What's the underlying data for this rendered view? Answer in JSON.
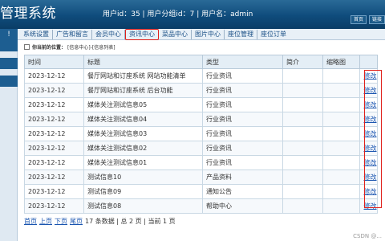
{
  "header": {
    "title": "管理系统",
    "user_info": "用户id：35 | 用户分组id：7 | 用户名：admin",
    "links": [
      "首页",
      "链接"
    ]
  },
  "nav": {
    "items": [
      "系统设置",
      "广告和留言",
      "会员中心",
      "资讯中心",
      "菜品中心",
      "图片中心",
      "座位管理",
      "座位订单"
    ],
    "active_index": 3
  },
  "breadcrumb": {
    "label": "你当前的位置：",
    "path": "[信息中心]-[信息列表]"
  },
  "table": {
    "columns": [
      "时间",
      "标题",
      "类型",
      "简介",
      "缩略图",
      ""
    ],
    "rows": [
      {
        "time": "2023-12-12",
        "title": "餐厅网站和订座系统 网站功能清单",
        "type": "行业资讯",
        "intro": "",
        "thumb": "",
        "action": "修改"
      },
      {
        "time": "2023-12-12",
        "title": "餐厅网站和订座系统 后台功能",
        "type": "行业资讯",
        "intro": "",
        "thumb": "",
        "action": "修改"
      },
      {
        "time": "2023-12-12",
        "title": "媒体关注测试信息05",
        "type": "行业资讯",
        "intro": "",
        "thumb": "",
        "action": "修改"
      },
      {
        "time": "2023-12-12",
        "title": "媒体关注测试信息04",
        "type": "行业资讯",
        "intro": "",
        "thumb": "",
        "action": "修改"
      },
      {
        "time": "2023-12-12",
        "title": "媒体关注测试信息03",
        "type": "行业资讯",
        "intro": "",
        "thumb": "",
        "action": "修改"
      },
      {
        "time": "2023-12-12",
        "title": "媒体关注测试信息02",
        "type": "行业资讯",
        "intro": "",
        "thumb": "",
        "action": "修改"
      },
      {
        "time": "2023-12-12",
        "title": "媒体关注测试信息01",
        "type": "行业资讯",
        "intro": "",
        "thumb": "",
        "action": "修改"
      },
      {
        "time": "2023-12-12",
        "title": "测试信息10",
        "type": "产品资料",
        "intro": "",
        "thumb": "",
        "action": "修改"
      },
      {
        "time": "2023-12-12",
        "title": "测试信息09",
        "type": "通知公告",
        "intro": "",
        "thumb": "",
        "action": "修改"
      },
      {
        "time": "2023-12-12",
        "title": "测试信息08",
        "type": "帮助中心",
        "intro": "",
        "thumb": "",
        "action": "修改"
      }
    ]
  },
  "pager": {
    "first": "首页",
    "prev": "上页",
    "next": "下页",
    "last": "尾页",
    "summary": "17 条数据 | 总 2 页 | 当前 1 页"
  },
  "watermark": "CSDN @...",
  "colors": {
    "header": "#0f4c7c",
    "highlight": "#e0201b",
    "link": "#1a55b0"
  }
}
